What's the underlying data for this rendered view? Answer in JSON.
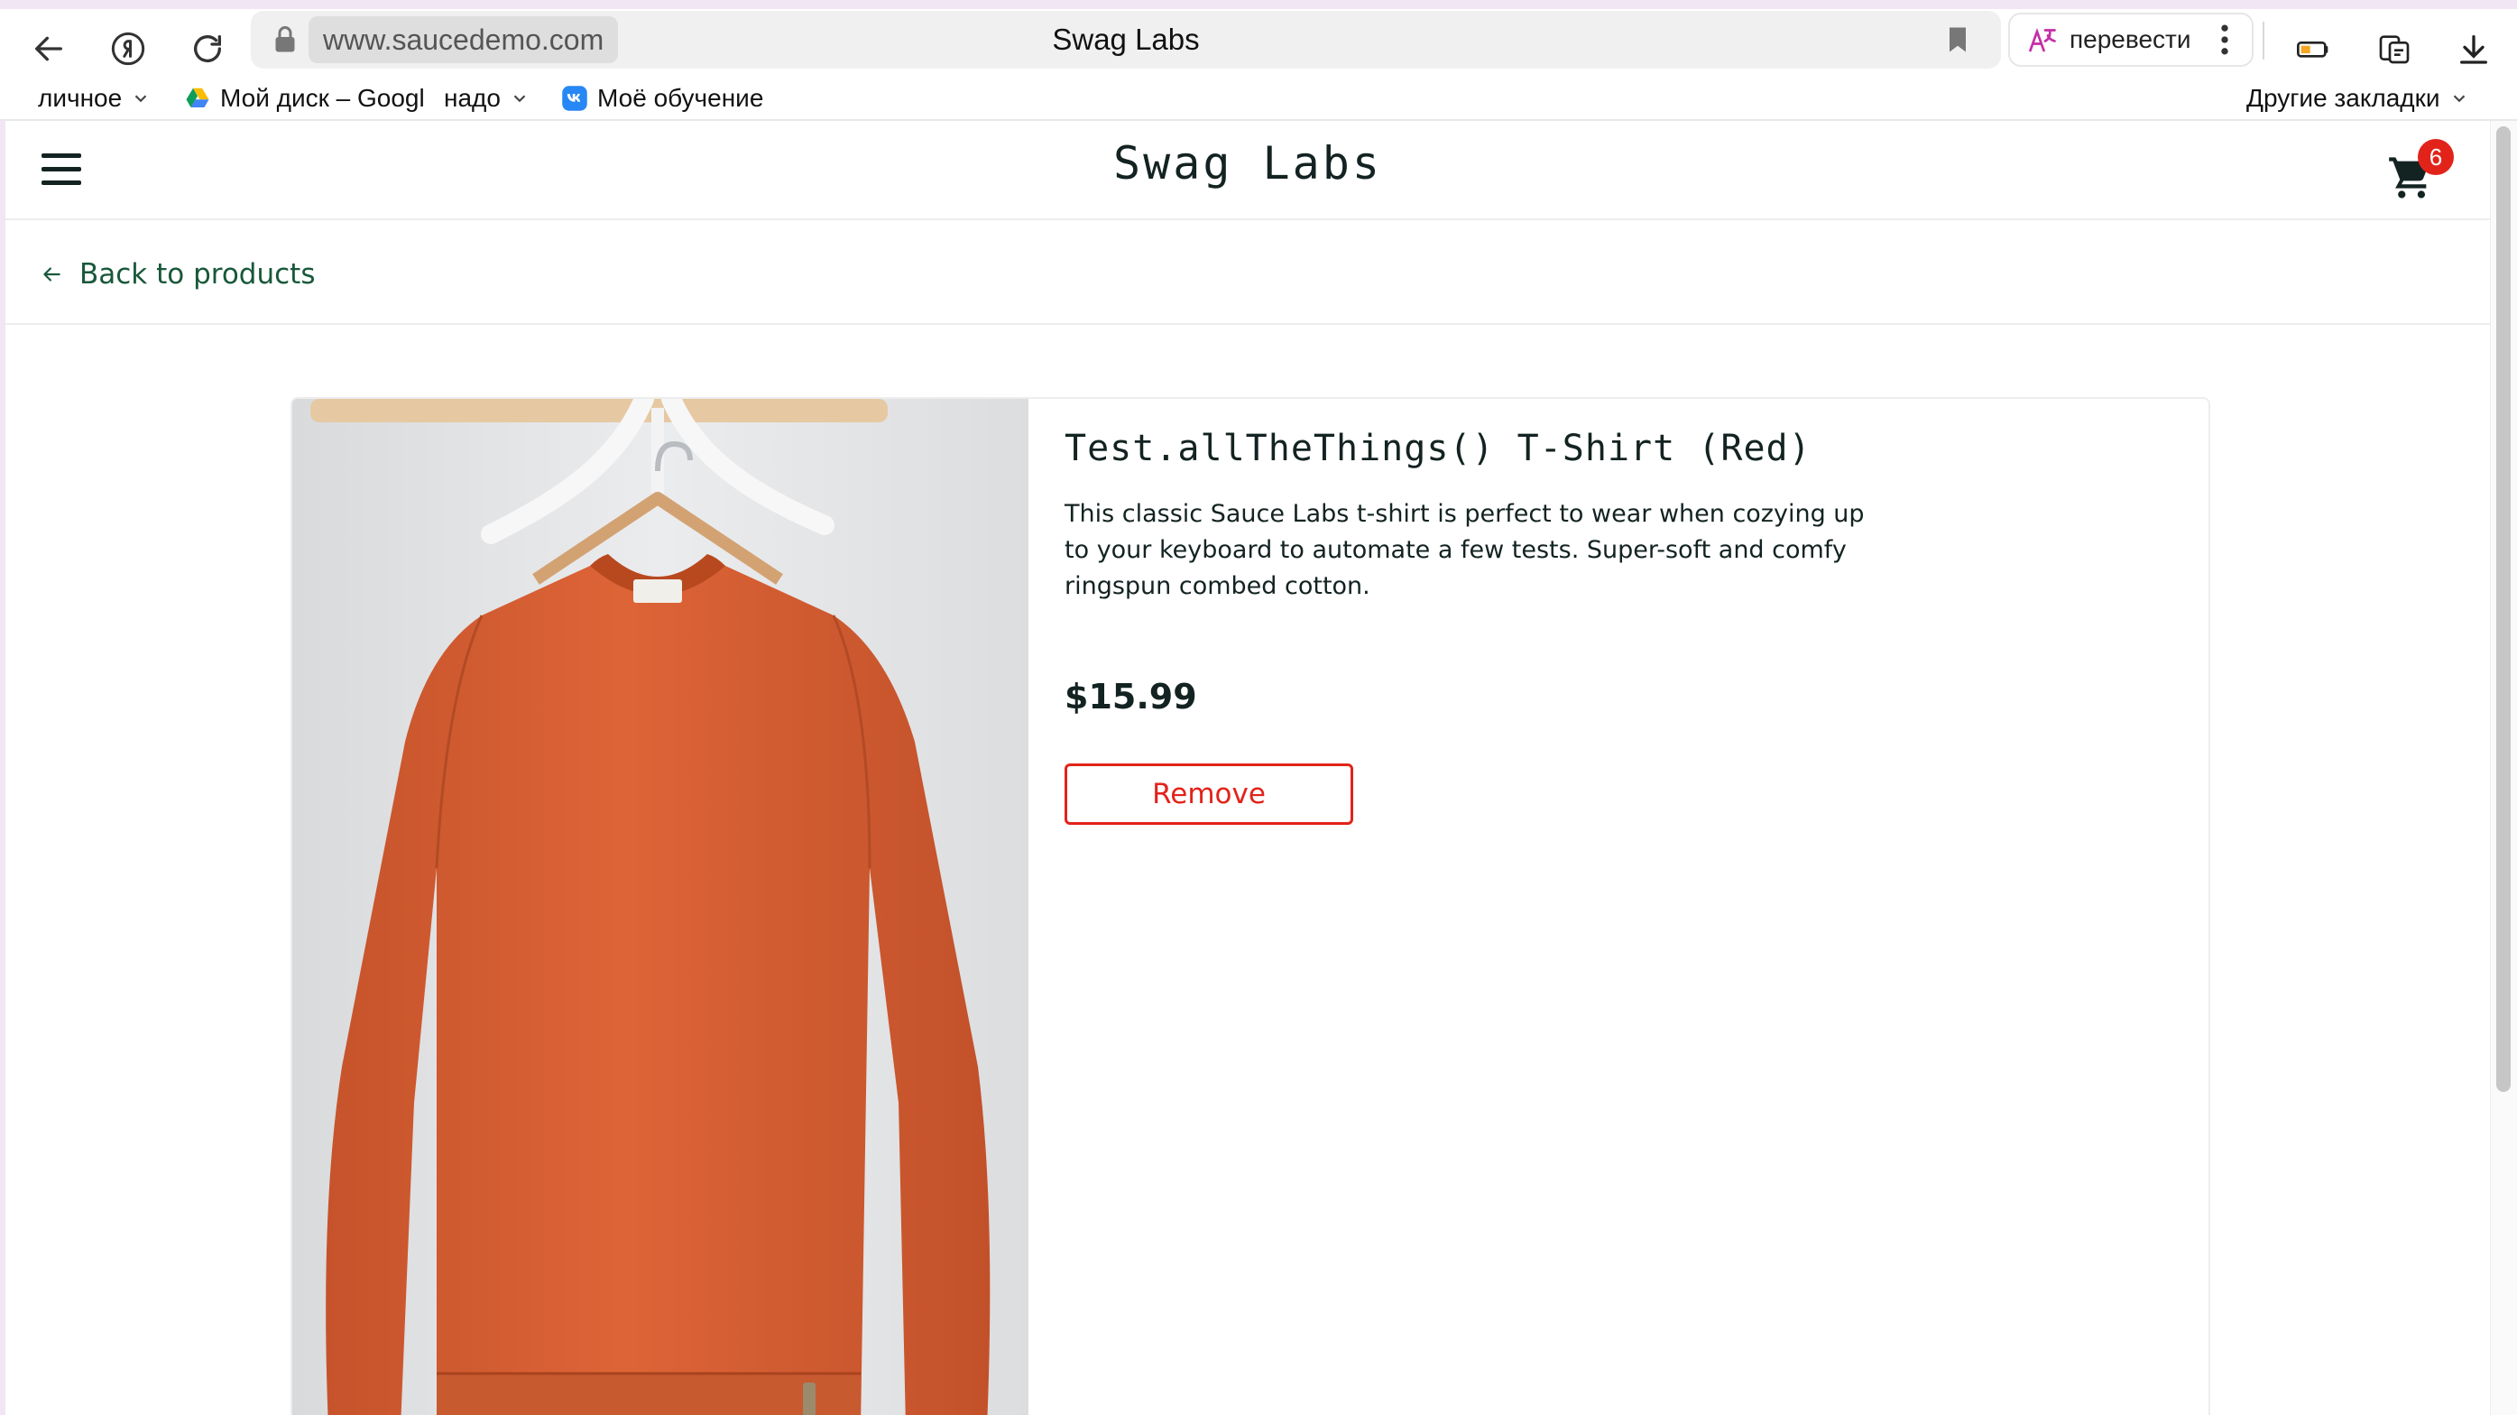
{
  "browser": {
    "url": "www.saucedemo.com",
    "tab_title": "Swag Labs",
    "translate_label": "перевести",
    "bookmarks": [
      {
        "label": "личное",
        "has_menu": true
      },
      {
        "label": "Мой диск – Googl",
        "icon": "google-drive-icon"
      },
      {
        "label": "надо",
        "has_menu": true
      },
      {
        "label": "Моё обучение",
        "icon": "vk-icon"
      }
    ],
    "other_bookmarks": "Другие закладки"
  },
  "header": {
    "logo": "Swag Labs",
    "cart_count": "6"
  },
  "subheader": {
    "back_label": "Back to products"
  },
  "product": {
    "name": "Test.allTheThings() T-Shirt (Red)",
    "description": "This classic Sauce Labs t-shirt is perfect to wear when cozying up to your keyboard to automate a few tests. Super-soft and comfy ringspun combed cotton.",
    "price": "$15.99",
    "action_label": "Remove",
    "image_icon": "red-sweatshirt-on-hanger"
  },
  "colors": {
    "accent_red": "#e2231a",
    "link_green": "#18583a",
    "text_dark": "#132322",
    "shirt_orange": "#d35f35"
  }
}
